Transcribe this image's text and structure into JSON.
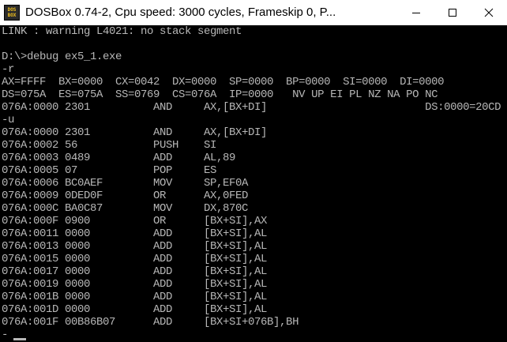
{
  "window": {
    "title": "DOSBox 0.74-2, Cpu speed:     3000 cycles, Frameskip  0, P...",
    "icon_name": "dosbox-icon",
    "icon_text_top": "DOS",
    "icon_text_bottom": "BOX",
    "controls": [
      "minimize-icon",
      "maximize-icon",
      "close-icon"
    ]
  },
  "console": {
    "background": "#000000",
    "foreground": "#b7b7b7",
    "lines": [
      "LINK : warning L4021: no stack segment",
      "",
      "D:\\>debug ex5_1.exe",
      "-r",
      "AX=FFFF  BX=0000  CX=0042  DX=0000  SP=0000  BP=0000  SI=0000  DI=0000",
      "DS=075A  ES=075A  SS=0769  CS=076A  IP=0000   NV UP EI PL NZ NA PO NC",
      "076A:0000 2301          AND     AX,[BX+DI]                         DS:0000=20CD",
      "-u",
      "076A:0000 2301          AND     AX,[BX+DI]",
      "076A:0002 56            PUSH    SI",
      "076A:0003 0489          ADD     AL,89",
      "076A:0005 07            POP     ES",
      "076A:0006 BC0AEF        MOV     SP,EF0A",
      "076A:0009 0DED0F        OR      AX,0FED",
      "076A:000C BA0C87        MOV     DX,870C",
      "076A:000F 0900          OR      [BX+SI],AX",
      "076A:0011 0000          ADD     [BX+SI],AL",
      "076A:0013 0000          ADD     [BX+SI],AL",
      "076A:0015 0000          ADD     [BX+SI],AL",
      "076A:0017 0000          ADD     [BX+SI],AL",
      "076A:0019 0000          ADD     [BX+SI],AL",
      "076A:001B 0000          ADD     [BX+SI],AL",
      "076A:001D 0000          ADD     [BX+SI],AL",
      "076A:001F 00B86B07      ADD     [BX+SI+076B],BH",
      "-"
    ]
  }
}
